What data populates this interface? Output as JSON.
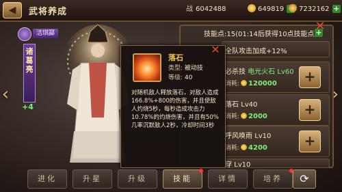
{
  "header": {
    "back_icon": "back-arrow-icon",
    "title": "武将养成",
    "power_label": "战",
    "power_value": "6042488",
    "gold_value": "649819",
    "ingot_value": "7232162"
  },
  "hero": {
    "tag": "洁琪酃",
    "name": "诸葛亮",
    "level": "+4"
  },
  "skills_panel": {
    "points_label": "技能点",
    "points_value": "15",
    "points_timer": "(01:14后获得10点技能点)",
    "rows": [
      {
        "name": "全队攻击加成+12%",
        "named_skill": "",
        "level": "",
        "cost_label": "",
        "cost": ""
      },
      {
        "name": "必杀技",
        "named_skill": "电光火石 Lv60",
        "level": "",
        "cost_label": "消耗:",
        "cost": "120000"
      },
      {
        "name": "落石",
        "named_skill": "",
        "level": "Lv40",
        "cost_label": "消耗:",
        "cost": "2000"
      },
      {
        "name": "呼风唤雨",
        "named_skill": "",
        "level": "Lv10",
        "cost_label": "消耗:",
        "cost": "4200"
      },
      {
        "name": "穿",
        "named_skill": "",
        "level": "Lv10",
        "cost_label": "",
        "cost": ""
      }
    ]
  },
  "popup": {
    "skill_name": "落石",
    "type_label": "类型:",
    "type_value": "被动技",
    "level_label": "等级:",
    "level_value": "40",
    "description": "对随机敌人释放落石，对敌人造成166.8%+800的伤害，并且使敌人灼烧5秒，每秒造成攻击力10.78%的灼烧伤害，并且有50%几率沉默敌人2秒，冷却时间3秒"
  },
  "tabs": [
    {
      "label": "进化",
      "active": false,
      "badge": false
    },
    {
      "label": "升星",
      "active": false,
      "badge": false
    },
    {
      "label": "升级",
      "active": false,
      "badge": false
    },
    {
      "label": "技能",
      "active": true,
      "badge": true
    },
    {
      "label": "详情",
      "active": false,
      "badge": false
    },
    {
      "label": "培养",
      "active": false,
      "badge": true
    }
  ],
  "colors": {
    "accent_green": "#7cf07a",
    "title_gold": "#f2c84a",
    "close_red": "#e44a2a"
  }
}
